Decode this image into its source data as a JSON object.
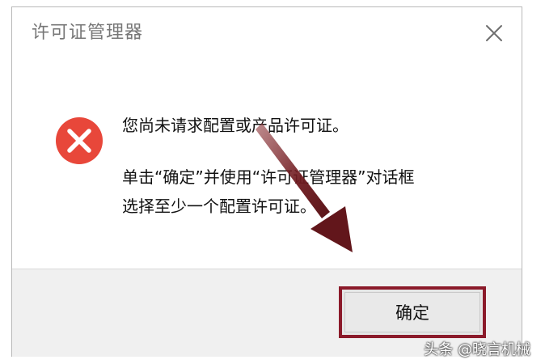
{
  "dialog": {
    "title": "许可证管理器",
    "close_icon": "close-icon",
    "message_icon": "error-icon",
    "message_line1": "您尚未请求配置或产品许可证。",
    "message_line2": "单击“确定”并使用“许可证管理器”对话框",
    "message_line3": "选择至少一个配置许可证。",
    "ok_label": "确定"
  },
  "annotation": {
    "arrow_color": "#7a1f24",
    "highlight_color": "#8b1a2a"
  },
  "watermark": {
    "text": "头条 @晓言机械"
  },
  "colors": {
    "error_red": "#e8473a",
    "footer_bg": "#f0f0f0"
  }
}
